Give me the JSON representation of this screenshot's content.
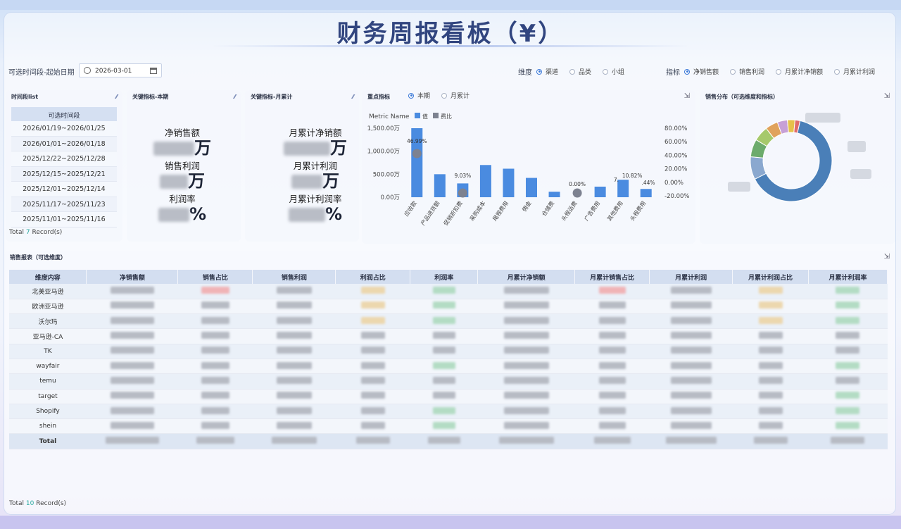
{
  "title": "财务周报看板（¥）",
  "filters": {
    "date_label": "可选时间段-起始日期",
    "date_value": "2026-03-01",
    "dimension_label": "维度",
    "dimension_options": [
      "渠道",
      "品类",
      "小组"
    ],
    "dimension_selected": "渠道",
    "metric_label": "指标",
    "metric_options": [
      "净销售额",
      "销售利润",
      "月累计净销额",
      "月累计利润"
    ],
    "metric_selected": "净销售额"
  },
  "period_panel": {
    "title": "时间段list",
    "header": "可选时间段",
    "items": [
      "2026/01/19~2026/01/25",
      "2026/01/01~2026/01/18",
      "2025/12/22~2025/12/28",
      "2025/12/15~2025/12/21",
      "2025/12/01~2025/12/14",
      "2025/11/17~2025/11/23",
      "2025/11/01~2025/11/16"
    ],
    "total_prefix": "Total",
    "total_count": "7",
    "total_suffix": "Record(s)"
  },
  "kpi_current": {
    "title": "关键指标-本期",
    "items": [
      {
        "label": "净销售额",
        "unit": "万"
      },
      {
        "label": "销售利润",
        "unit": "万"
      },
      {
        "label": "利润率",
        "unit": "%"
      }
    ]
  },
  "kpi_month": {
    "title": "关键指标-月累计",
    "items": [
      {
        "label": "月累计净销额",
        "unit": "万"
      },
      {
        "label": "月累计利润",
        "unit": "万"
      },
      {
        "label": "月累计利润率",
        "unit": "%"
      }
    ]
  },
  "key_metrics": {
    "title": "重点指标",
    "toggle_options": [
      "本期",
      "月累计"
    ],
    "toggle_selected": "本期",
    "legend_title": "Metric Name",
    "legend_items": [
      "值",
      "费比"
    ],
    "colors": {
      "bar": "#4a8be0",
      "ratio": "#7d8290"
    }
  },
  "chart_data": {
    "type": "bar",
    "categories": [
      "应收款",
      "产品进货额",
      "促销折扣费",
      "采购成本",
      "尾程费用",
      "佣金",
      "仓储费",
      "头程运费",
      "广告费用",
      "其他费用",
      "头程费用"
    ],
    "series": [
      {
        "name": "值",
        "values": [
          1500,
          500,
          300,
          700,
          620,
          420,
          120,
          0,
          230,
          380,
          180
        ]
      },
      {
        "name": "费比",
        "values": [
          46.99,
          null,
          9.03,
          null,
          null,
          null,
          null,
          0.0,
          null,
          null,
          null
        ]
      }
    ],
    "y_left_ticks": [
      "0.00万",
      "500.00万",
      "1,000.00万",
      "1,500.00万"
    ],
    "y_right_ticks": [
      "-20.00%",
      "0.00%",
      "20.00%",
      "40.00%",
      "60.00%",
      "80.00%"
    ],
    "data_labels": [
      "46.99%",
      "9.03%",
      "0.00%",
      "7.",
      "10.82%",
      ".44%"
    ]
  },
  "sales_dist": {
    "title": "销售分布（可选维度和指标）",
    "type": "pie",
    "slices": [
      {
        "value": 64,
        "color": "#4a7fb8"
      },
      {
        "value": 9,
        "color": "#8aa8cf"
      },
      {
        "value": 7,
        "color": "#6cab6c"
      },
      {
        "value": 6,
        "color": "#a6c96b"
      },
      {
        "value": 5,
        "color": "#e0a25b"
      },
      {
        "value": 4,
        "color": "#c7a0d6"
      },
      {
        "value": 3,
        "color": "#e6c24a"
      },
      {
        "value": 2,
        "color": "#e06b6b"
      }
    ]
  },
  "sales_table": {
    "title": "销售报表（可选维度）",
    "columns": [
      "维度内容",
      "净销售额",
      "销售占比",
      "销售利润",
      "利润占比",
      "利润率",
      "月累计净销额",
      "月累计销售占比",
      "月累计利润",
      "月累计利润占比",
      "月累计利润率"
    ],
    "rows": [
      "北美亚马逊",
      "欧洲亚马逊",
      "沃尔玛",
      "亚马逊-CA",
      "TK",
      "wayfair",
      "temu",
      "target",
      "Shopify",
      "shein",
      "Total"
    ],
    "total_prefix": "Total",
    "total_count": "10",
    "total_suffix": "Record(s)"
  }
}
